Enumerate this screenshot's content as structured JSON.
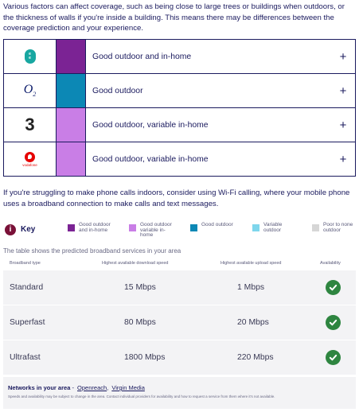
{
  "intro_text": "Various factors can affect coverage, such as being close to large trees or buildings when outdoors, or the thickness of walls if you're inside a building. This means there may be differences between the coverage prediction and your experience.",
  "providers": [
    {
      "name": "EE",
      "logo_text": "ee",
      "swatch_color": "#7b2394",
      "coverage": "Good outdoor and in-home",
      "expand_icon": "+"
    },
    {
      "name": "O2",
      "logo_text": "O2",
      "swatch_color": "#0c88b5",
      "coverage": "Good outdoor",
      "expand_icon": "+"
    },
    {
      "name": "Three",
      "logo_text": "3",
      "swatch_color": "#c97ee6",
      "coverage": "Good outdoor, variable in-home",
      "expand_icon": "+"
    },
    {
      "name": "Vodafone",
      "logo_text": "vodafone",
      "swatch_color": "#c97ee6",
      "coverage": "Good outdoor, variable in-home",
      "expand_icon": "+"
    }
  ],
  "wifi_note": "If you're struggling to make phone calls indoors, consider using Wi-Fi calling, where your mobile phone uses a broadband connection to make calls and text messages.",
  "key": {
    "badge": "i",
    "title": "Key",
    "items": [
      {
        "label": "Good outdoor and in-home",
        "color": "#7b2394"
      },
      {
        "label": "Good outdoor variable in-home",
        "color": "#c97ee6"
      },
      {
        "label": "Good outdoor",
        "color": "#0c88b5"
      },
      {
        "label": "Variable outdoor",
        "color": "#7fd6ec"
      },
      {
        "label": "Poor to none outdoor",
        "color": "#d6d6d6"
      }
    ]
  },
  "broadband": {
    "caption": "The table shows the predicted broadband services in your area",
    "headers": {
      "type": "Broadband type",
      "download": "Highest available download speed",
      "upload": "Highest available upload speed",
      "availability": "Availability"
    },
    "rows": [
      {
        "type": "Standard",
        "download": "15 Mbps",
        "upload": "1 Mbps",
        "available": true
      },
      {
        "type": "Superfast",
        "download": "80 Mbps",
        "upload": "20 Mbps",
        "available": true
      },
      {
        "type": "Ultrafast",
        "download": "1800 Mbps",
        "upload": "220 Mbps",
        "available": true
      }
    ],
    "check_color": "#2e8540"
  },
  "networks": {
    "label": "Networks in your area",
    "separator": " - ",
    "links": [
      "Openreach",
      "Virgin Media"
    ],
    "disclaimer": "Speeds and availability may be subject to change in the area. Contact individual providers for availability and how to request a service from them where it's not available."
  }
}
